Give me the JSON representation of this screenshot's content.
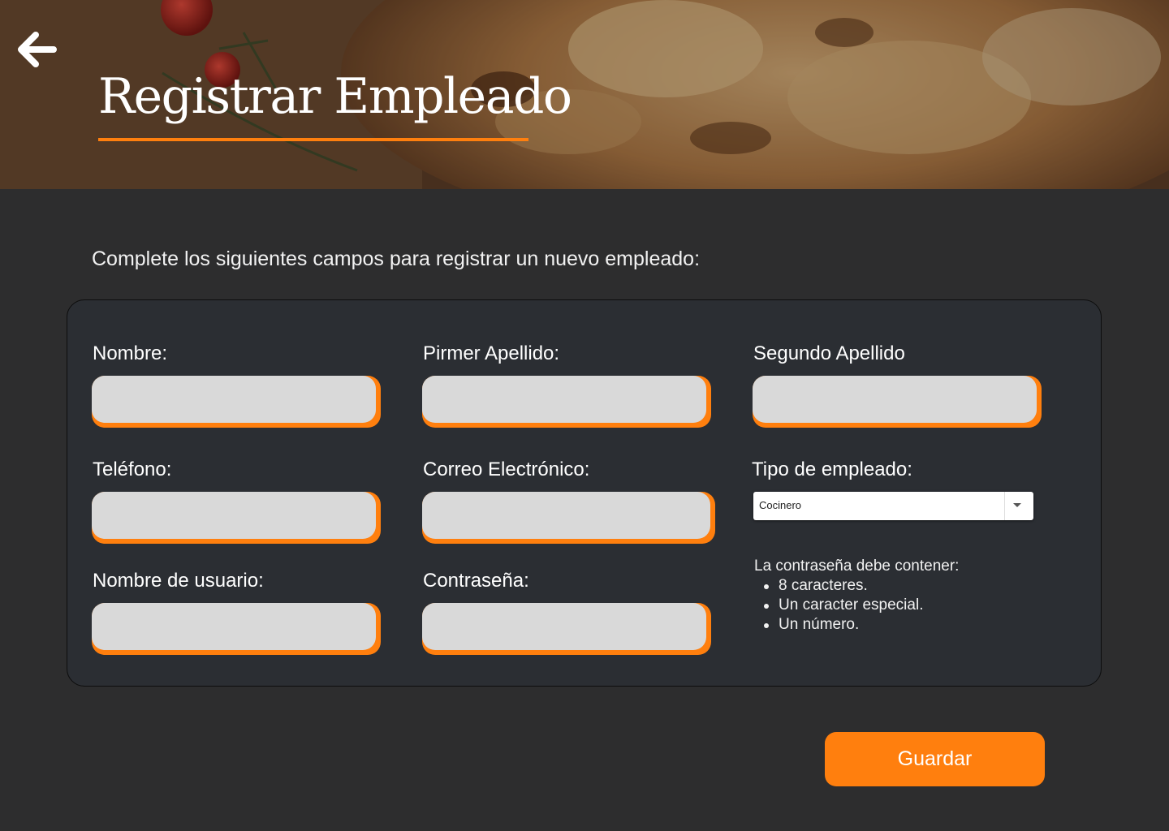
{
  "header": {
    "title": "Registrar Empleado",
    "back_icon": "arrow-left-icon"
  },
  "intro": "Complete los siguientes campos para registrar un nuevo empleado:",
  "form": {
    "nombre_label": "Nombre:",
    "primer_apellido_label": "Pirmer Apellido:",
    "segundo_apellido_label": "Segundo Apellido",
    "telefono_label": "Teléfono:",
    "correo_label": "Correo Electrónico:",
    "tipo_label": "Tipo de empleado:",
    "tipo_value": "Cocinero",
    "usuario_label": "Nombre de usuario:",
    "contrasena_label": "Contraseña:",
    "fields": {
      "nombre": "",
      "primer_apellido": "",
      "segundo_apellido": "",
      "telefono": "",
      "correo": "",
      "usuario": "",
      "contrasena": ""
    }
  },
  "password_rules": {
    "heading": "La contraseña debe contener:",
    "items": [
      "8 caracteres.",
      "Un caracter especial.",
      "Un número."
    ]
  },
  "save_label": "Guardar",
  "colors": {
    "accent": "#ff7f0e",
    "page_bg": "#2d2d2e",
    "card_bg": "#2b2e33",
    "input_bg": "#d9d9d9"
  }
}
